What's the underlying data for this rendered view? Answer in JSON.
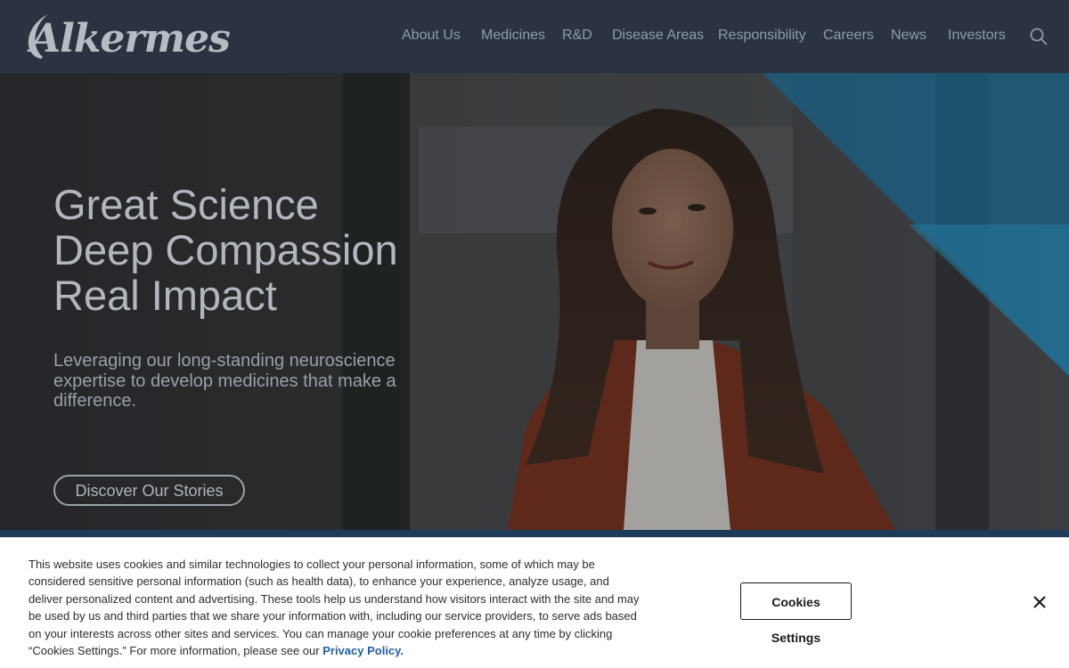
{
  "header": {
    "logo_text": "Alkermes",
    "nav": [
      {
        "label": "About Us"
      },
      {
        "label": "Medicines"
      },
      {
        "label": "R&D"
      },
      {
        "label": "Disease Areas"
      },
      {
        "label": "Responsibility"
      },
      {
        "label": "Careers"
      },
      {
        "label": "News"
      },
      {
        "label": "Investors"
      }
    ],
    "search_icon": "search-icon"
  },
  "hero": {
    "headline": [
      "Great Science",
      "Deep Compassion",
      "Real Impact"
    ],
    "subtext": "Leveraging our long-standing neuroscience expertise to develop medicines that make a difference.",
    "cta_label": "Discover Our Stories"
  },
  "cookie_banner": {
    "text": "This website uses cookies and similar technologies to collect your personal information, some of which may be considered sensitive personal information (such as health data), to enhance your experience, analyze usage, and deliver personalized content and advertising. These tools help us understand how visitors interact with the site and may be used by us and third parties that we share your information with, including our service providers, to serve ads based on your interests across other sites and services. You can manage your cookie preferences at any time by clicking “Cookies Settings.” For more information, please see our",
    "link_label": "Privacy Policy.",
    "settings_label": "Cookies Settings",
    "close_icon": "close-icon"
  },
  "colors": {
    "header_bg": "#2b3340",
    "accent_blue": "#1f5fa8",
    "hero_triangle": "#1e6e98"
  }
}
